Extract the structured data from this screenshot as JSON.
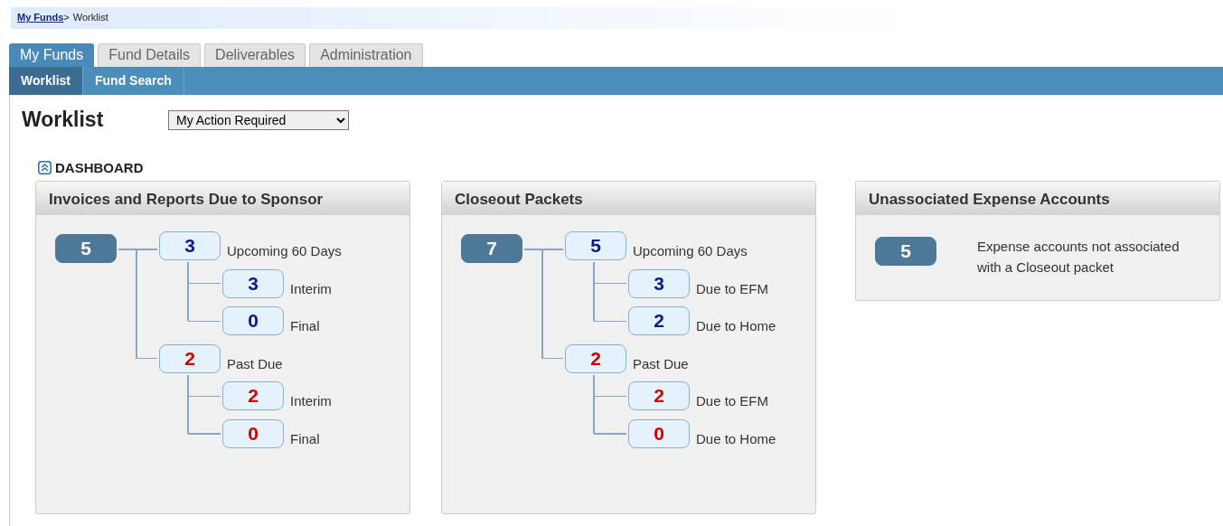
{
  "breadcrumb": {
    "link": "My Funds",
    "separator": ">",
    "current": "Worklist"
  },
  "tabs": [
    {
      "label": "My Funds",
      "selected": true
    },
    {
      "label": "Fund Details",
      "selected": false
    },
    {
      "label": "Deliverables",
      "selected": false
    },
    {
      "label": "Administration",
      "selected": false
    }
  ],
  "subtabs": [
    {
      "label": "Worklist",
      "selected": true
    },
    {
      "label": "Fund Search",
      "selected": false
    }
  ],
  "page_title": "Worklist",
  "view_select": {
    "value": "My Action Required"
  },
  "dashboard": {
    "label": "DASHBOARD",
    "expanded": true
  },
  "panels": [
    {
      "title": "Invoices and Reports Due to Sponsor",
      "kind": "tree",
      "total": "5",
      "groups": [
        {
          "count": "3",
          "label": "Upcoming 60 Days",
          "kind": "upcoming",
          "children": [
            {
              "count": "3",
              "label": "Interim"
            },
            {
              "count": "0",
              "label": "Final"
            }
          ]
        },
        {
          "count": "2",
          "label": "Past Due",
          "kind": "past_due",
          "children": [
            {
              "count": "2",
              "label": "Interim"
            },
            {
              "count": "0",
              "label": "Final"
            }
          ]
        }
      ]
    },
    {
      "title": "Closeout Packets",
      "kind": "tree",
      "total": "7",
      "groups": [
        {
          "count": "5",
          "label": "Upcoming 60 Days",
          "kind": "upcoming",
          "children": [
            {
              "count": "3",
              "label": "Due to EFM"
            },
            {
              "count": "2",
              "label": "Due to Home"
            }
          ]
        },
        {
          "count": "2",
          "label": "Past Due",
          "kind": "past_due",
          "children": [
            {
              "count": "2",
              "label": "Due to EFM"
            },
            {
              "count": "0",
              "label": "Due to Home"
            }
          ]
        }
      ]
    },
    {
      "title": "Unassociated Expense Accounts",
      "kind": "summary",
      "count": "5",
      "text": "Expense accounts not associated with a Closeout packet"
    }
  ]
}
